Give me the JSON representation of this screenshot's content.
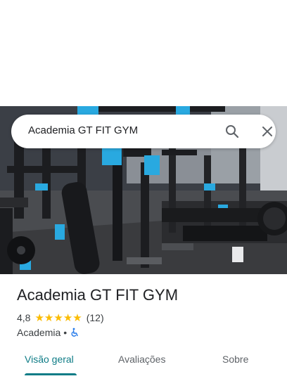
{
  "search": {
    "query": "Academia GT FIT GYM",
    "search_icon": "search-icon",
    "close_icon": "close-icon"
  },
  "place": {
    "title": "Academia GT FIT GYM",
    "rating": "4,8",
    "stars": 5,
    "review_count": "(12)",
    "category": "Academia",
    "separator": "•",
    "accessibility_icon": "wheelchair-accessible-icon"
  },
  "tabs": [
    {
      "label": "Visão geral",
      "active": true
    },
    {
      "label": "Avaliações",
      "active": false
    },
    {
      "label": "Sobre",
      "active": false
    }
  ],
  "colors": {
    "accent": "#0e7c86",
    "star": "#fbbc04",
    "equipment_blue": "#29a9e0"
  }
}
